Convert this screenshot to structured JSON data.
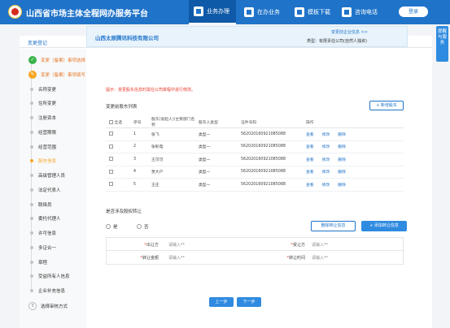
{
  "header": {
    "title": "山西省市场主体全程网办服务平台",
    "nav": [
      {
        "label": "业务办理",
        "icon": "briefcase-icon",
        "active": true
      },
      {
        "label": "在办业务",
        "icon": "document-icon",
        "active": false
      },
      {
        "label": "模板下载",
        "icon": "download-icon",
        "active": false
      },
      {
        "label": "咨询电话",
        "icon": "phone-icon",
        "active": false
      }
    ],
    "login": "登录"
  },
  "side_tab": "提醒与服务",
  "panel": {
    "title": "变更登记"
  },
  "sidebar": {
    "steps": [
      {
        "label": "变更（备案）事项选择",
        "state": "done"
      },
      {
        "label": "变更（备案）事项填写",
        "state": "current"
      },
      {
        "label": "名称变更",
        "state": "pending"
      },
      {
        "label": "住所变更",
        "state": "pending"
      },
      {
        "label": "注册资本",
        "state": "pending"
      },
      {
        "label": "经营期限",
        "state": "pending"
      },
      {
        "label": "经营范围",
        "state": "pending"
      },
      {
        "label": "股东信息",
        "state": "active"
      },
      {
        "label": "高级管理人员",
        "state": "pending"
      },
      {
        "label": "法定代表人",
        "state": "pending"
      },
      {
        "label": "联络员",
        "state": "pending"
      },
      {
        "label": "委托代理人",
        "state": "pending"
      },
      {
        "label": "许可信息",
        "state": "pending"
      },
      {
        "label": "多证合一",
        "state": "pending"
      },
      {
        "label": "章程",
        "state": "pending"
      },
      {
        "label": "受益所有人信息",
        "state": "pending"
      },
      {
        "label": "企业补充信息",
        "state": "pending"
      },
      {
        "label": "选择审核方式",
        "state": "number",
        "num": "3"
      }
    ]
  },
  "company": {
    "name": "山西太原腾讯科技有限公司",
    "link": "变更前企业信息 >>",
    "type_label": "类型：",
    "type_value": "有限责任公司(自然人独资)"
  },
  "tip": "提示：变更股东信息时需在公司章程中进行修改。",
  "shareholders": {
    "title": "变更前股东列表",
    "add_button": "+ 新增股东",
    "columns": [
      "全选",
      "序号",
      "股东(发起人)/主要部门名称",
      "股东人类型",
      "证件号码",
      "操作"
    ],
    "rows": [
      {
        "no": "1",
        "name": "张飞",
        "type": "类型一",
        "id": "562020160921085088"
      },
      {
        "no": "2",
        "name": "张彰电",
        "type": "类型一",
        "id": "562020160921085088"
      },
      {
        "no": "3",
        "name": "王可可",
        "type": "类型一",
        "id": "562020160921085088"
      },
      {
        "no": "4",
        "name": "贾大户",
        "type": "类型一",
        "id": "562020160921085088"
      },
      {
        "no": "5",
        "name": "王庄",
        "type": "类型一",
        "id": "562020160921085088"
      }
    ],
    "actions": [
      "查看",
      "修改",
      "删除"
    ]
  },
  "transfer": {
    "title": "是否涉及股权转让",
    "yes": "是",
    "no": "否",
    "delete_button": "删除转让信息",
    "add_button": "+ 添加转让信息",
    "fields": [
      {
        "label": "出让方",
        "placeholder": "请输入**"
      },
      {
        "label": "受让方",
        "placeholder": "请输入**"
      },
      {
        "label": "转让金额",
        "placeholder": "请输入**"
      },
      {
        "label": "转让时间",
        "placeholder": "请输入**"
      }
    ]
  },
  "footer": {
    "prev": "上一步",
    "next": "下一步"
  }
}
